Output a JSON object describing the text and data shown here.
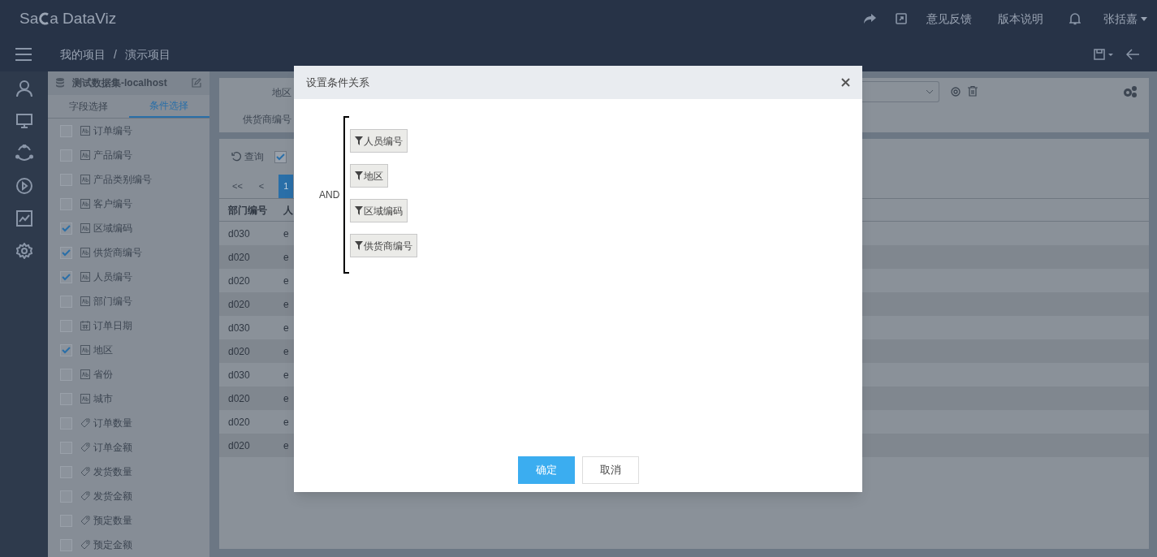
{
  "app": {
    "logo": "Sa",
    "logo_rest": "a DataViz"
  },
  "top_nav": [
    "意见反馈",
    "版本说明"
  ],
  "user": "张括嘉",
  "breadcrumb": [
    "我的项目",
    "/",
    "演示项目"
  ],
  "dataset": {
    "title": "测试数据集-localhost"
  },
  "panel_tabs": [
    {
      "label": "字段选择",
      "selected": false
    },
    {
      "label": "条件选择",
      "selected": true
    }
  ],
  "fields": [
    {
      "kind": "text",
      "label": "订单编号",
      "checked": false
    },
    {
      "kind": "text",
      "label": "产品编号",
      "checked": false
    },
    {
      "kind": "text",
      "label": "产品类别编号",
      "checked": false
    },
    {
      "kind": "text",
      "label": "客户编号",
      "checked": false
    },
    {
      "kind": "text",
      "label": "区域编码",
      "checked": true
    },
    {
      "kind": "text",
      "label": "供货商编号",
      "checked": true
    },
    {
      "kind": "text",
      "label": "人员编号",
      "checked": true
    },
    {
      "kind": "text",
      "label": "部门编号",
      "checked": false
    },
    {
      "kind": "date",
      "label": "订单日期",
      "checked": false
    },
    {
      "kind": "text",
      "label": "地区",
      "checked": true
    },
    {
      "kind": "text",
      "label": "省份",
      "checked": false
    },
    {
      "kind": "text",
      "label": "城市",
      "checked": false
    },
    {
      "kind": "number",
      "label": "订单数量",
      "checked": false
    },
    {
      "kind": "number",
      "label": "订单金额",
      "checked": false
    },
    {
      "kind": "number",
      "label": "发货数量",
      "checked": false
    },
    {
      "kind": "number",
      "label": "发货金额",
      "checked": false
    },
    {
      "kind": "number",
      "label": "预定数量",
      "checked": false
    },
    {
      "kind": "number",
      "label": "预定金额",
      "checked": false
    }
  ],
  "filters": [
    "地区",
    "供货商编号"
  ],
  "query": {
    "label": "查询",
    "checked": true
  },
  "pager": [
    {
      "label": "<<",
      "selected": false
    },
    {
      "label": "<",
      "selected": false
    },
    {
      "label": "1",
      "selected": true
    }
  ],
  "table": {
    "columns": [
      "部门编号",
      "人"
    ],
    "rows": [
      [
        "d030",
        "e"
      ],
      [
        "d020",
        "e"
      ],
      [
        "d020",
        "e"
      ],
      [
        "d020",
        "e"
      ],
      [
        "d030",
        "e"
      ],
      [
        "d020",
        "e"
      ],
      [
        "d030",
        "e"
      ],
      [
        "d020",
        "e"
      ],
      [
        "d020",
        "e"
      ],
      [
        "d020",
        "e"
      ]
    ]
  },
  "modal": {
    "title": "设置条件关系",
    "operator": "AND",
    "conditions": [
      "人员编号",
      "地区",
      "区域编码",
      "供货商编号"
    ],
    "buttons": [
      {
        "label": "确定",
        "kind": "primary"
      },
      {
        "label": "取消",
        "kind": "secondary"
      }
    ]
  }
}
